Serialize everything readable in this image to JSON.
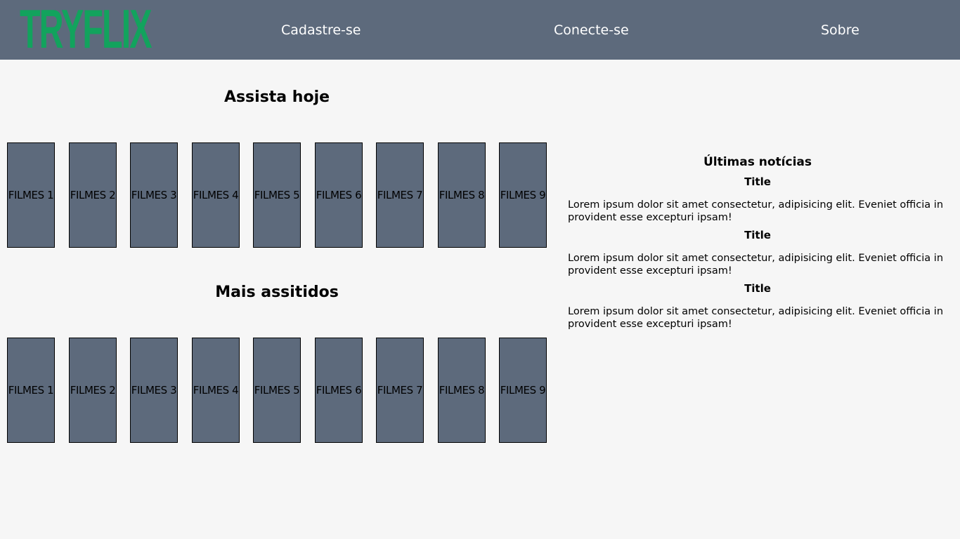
{
  "header": {
    "logo_text": "TRYFLIX",
    "nav": {
      "signup": "Cadastre-se",
      "login": "Conecte-se",
      "about": "Sobre"
    }
  },
  "sections": {
    "watch_today": {
      "title": "Assista hoje",
      "movies": [
        "FILMES 1",
        "FILMES 2",
        "FILMES 3",
        "FILMES 4",
        "FILMES 5",
        "FILMES 6",
        "FILMES 7",
        "FILMES 8",
        "FILMES 9"
      ]
    },
    "most_watched": {
      "title": "Mais assitidos",
      "movies": [
        "FILMES 1",
        "FILMES 2",
        "FILMES 3",
        "FILMES 4",
        "FILMES 5",
        "FILMES 6",
        "FILMES 7",
        "FILMES 8",
        "FILMES 9"
      ]
    }
  },
  "news": {
    "heading": "Últimas notícias",
    "items": [
      {
        "title": "Title",
        "text": "Lorem ipsum dolor sit amet consectetur, adipisicing elit. Eveniet officia in provident esse excepturi ipsam!"
      },
      {
        "title": "Title",
        "text": "Lorem ipsum dolor sit amet consectetur, adipisicing elit. Eveniet officia in provident esse excepturi ipsam!"
      },
      {
        "title": "Title",
        "text": "Lorem ipsum dolor sit amet consectetur, adipisicing elit. Eveniet officia in provident esse excepturi ipsam!"
      }
    ]
  },
  "colors": {
    "header_bg": "#5d6a7c",
    "logo": "#12a35d",
    "card_bg": "#5d6a7c",
    "page_bg": "#f6f6f6"
  }
}
